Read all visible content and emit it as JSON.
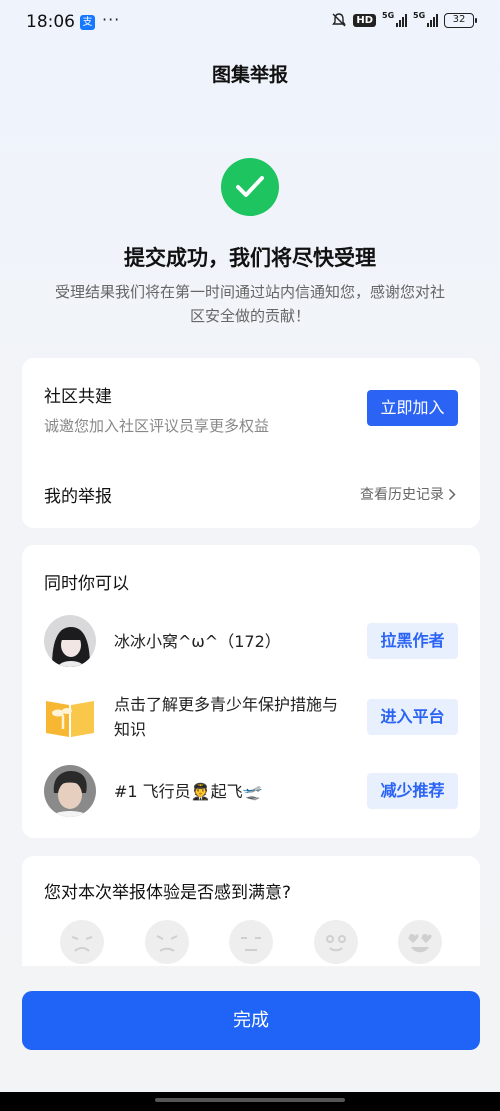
{
  "status_bar": {
    "time": "18:06",
    "app_icon_glyph": "支",
    "dots": "···",
    "hd": "HD",
    "signal_label": "5G",
    "signal2_label": "5G",
    "battery": "32"
  },
  "header": {
    "title": "图集举报"
  },
  "result": {
    "headline": "提交成功，我们将尽快受理",
    "subtext": "受理结果我们将在第一时间通过站内信通知您，感谢您对社区安全做的贡献！"
  },
  "community": {
    "title": "社区共建",
    "desc": "诚邀您加入社区评议员享更多权益",
    "join_label": "立即加入",
    "my_report": "我的举报",
    "history_link": "查看历史记录"
  },
  "also": {
    "title": "同时你可以",
    "items": [
      {
        "text": "冰冰小窝^ω^（172）",
        "button": "拉黑作者"
      },
      {
        "text": "点击了解更多青少年保护措施与知识",
        "button": "进入平台"
      },
      {
        "text": "#1 飞行员🧑‍✈️起飞🛫",
        "button": "减少推荐"
      }
    ]
  },
  "survey": {
    "question": "您对本次举报体验是否感到满意?",
    "faces": [
      "very-unsatisfied-face-icon",
      "unsatisfied-face-icon",
      "neutral-face-icon",
      "satisfied-face-icon",
      "very-satisfied-face-icon"
    ]
  },
  "footer": {
    "done_label": "完成"
  },
  "colors": {
    "primary": "#2b64f5",
    "success": "#1ec460"
  }
}
